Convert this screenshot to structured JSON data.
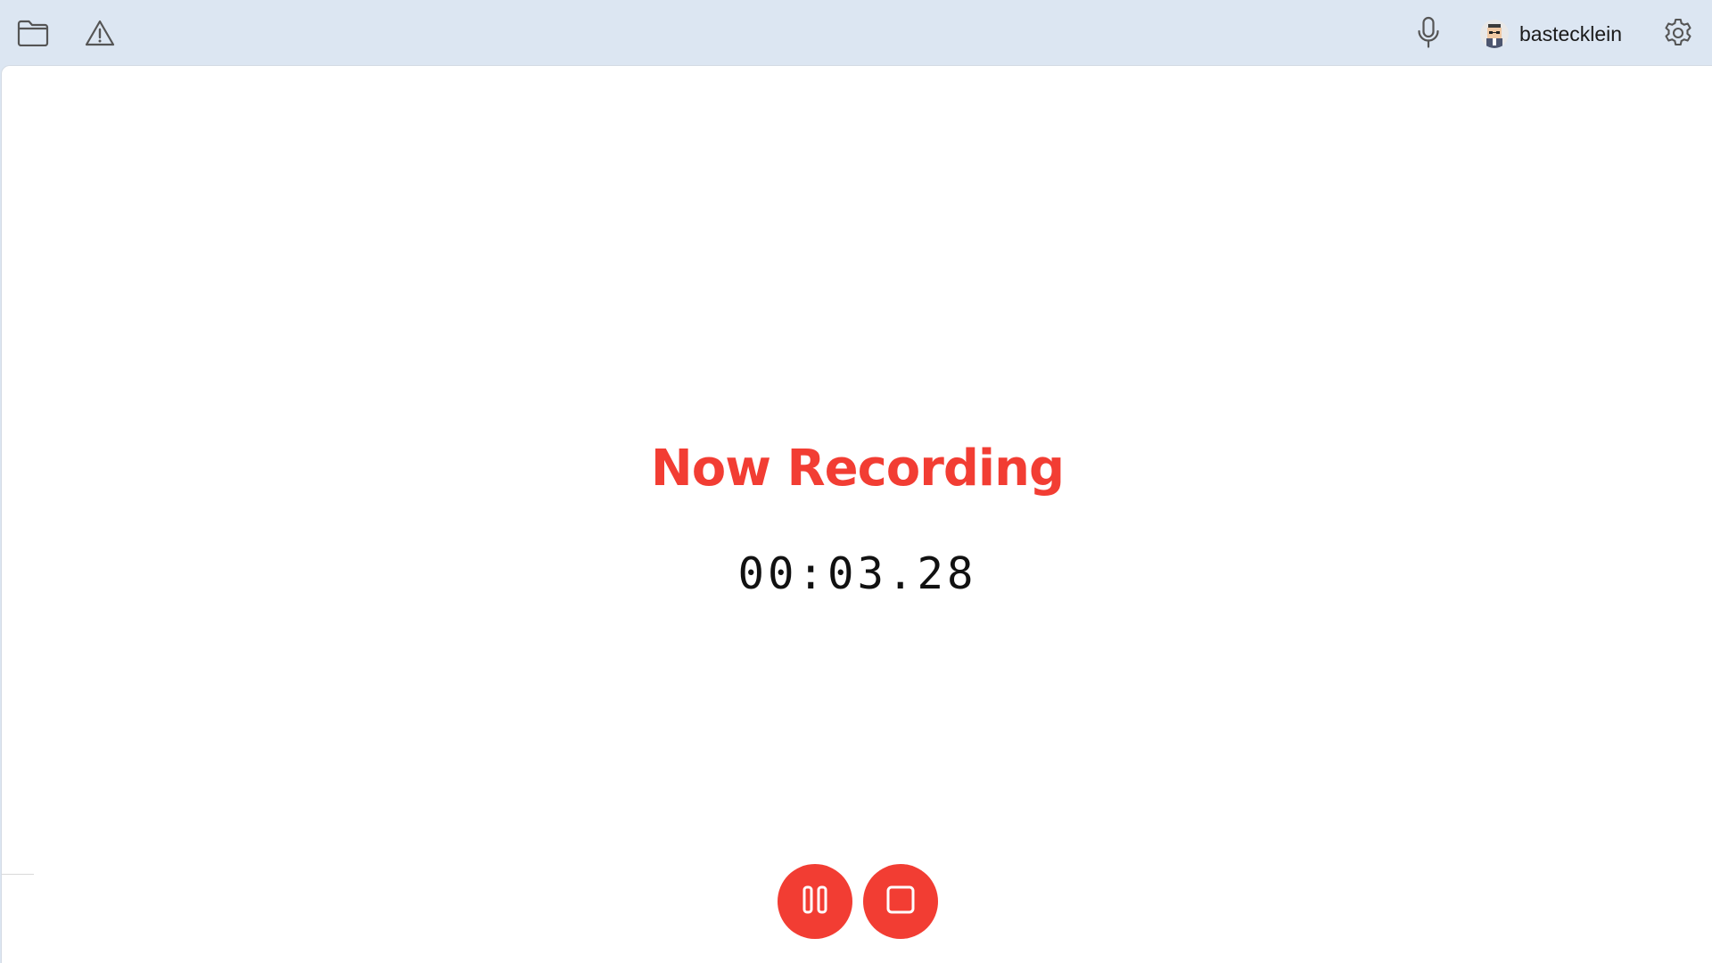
{
  "topbar": {
    "icons": {
      "folder": "folder-icon",
      "warning": "warning-icon",
      "microphone": "microphone-icon",
      "settings": "gear-icon"
    },
    "user": {
      "name": "bastecklein",
      "avatar": "user-avatar"
    }
  },
  "recording": {
    "status_title": "Now Recording",
    "elapsed": "00:03.28"
  },
  "controls": {
    "pause_icon": "pause-icon",
    "stop_icon": "stop-icon"
  },
  "colors": {
    "accent": "#f23d33",
    "topbar_bg": "#dce6f2",
    "panel_bg": "#ffffff",
    "icon_stroke": "#555555"
  }
}
